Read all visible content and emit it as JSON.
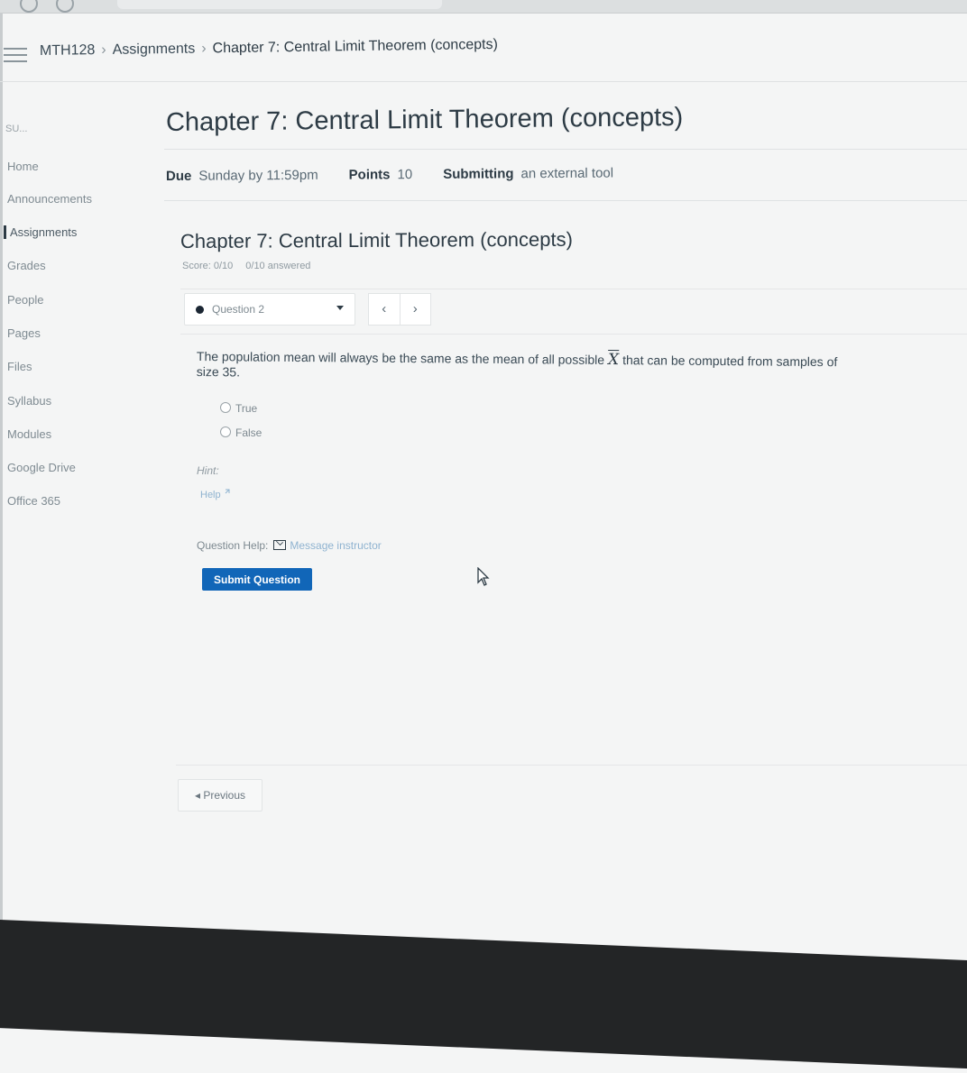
{
  "breadcrumb": [
    "MTH128",
    "Assignments",
    "Chapter 7: Central Limit Theorem (concepts)"
  ],
  "sidebar": {
    "course_code": "SU...",
    "items": [
      {
        "label": "Home",
        "active": false
      },
      {
        "label": "Announcements",
        "active": false
      },
      {
        "label": "Assignments",
        "active": true
      },
      {
        "label": "Grades",
        "active": false
      },
      {
        "label": "People",
        "active": false
      },
      {
        "label": "Pages",
        "active": false
      },
      {
        "label": "Files",
        "active": false
      },
      {
        "label": "Syllabus",
        "active": false
      },
      {
        "label": "Modules",
        "active": false
      },
      {
        "label": "Google Drive",
        "active": false
      },
      {
        "label": "Office 365",
        "active": false
      }
    ]
  },
  "page": {
    "title": "Chapter 7: Central Limit Theorem (concepts)",
    "due_label": "Due",
    "due_value": "Sunday by 11:59pm",
    "points_label": "Points",
    "points_value": "10",
    "submitting_label": "Submitting",
    "submitting_value": "an external tool"
  },
  "tool": {
    "title": "Chapter 7: Central Limit Theorem (concepts)",
    "score": "Score: 0/10",
    "answered": "0/10 answered",
    "question_select": "Question 2",
    "prev_arrow": "‹",
    "next_arrow": "›",
    "question_text_before": "The population mean will always be the same as the mean of all possible",
    "question_symbol": "X",
    "question_text_after": "that can be computed from samples of size 35.",
    "options": [
      "True",
      "False"
    ],
    "hint_label": "Hint:",
    "help_link": "Help",
    "question_help_label": "Question Help:",
    "message_instructor": "Message instructor",
    "submit_label": "Submit Question"
  },
  "footer": {
    "previous_label": "◂ Previous"
  },
  "colors": {
    "submit_button": "#1166b8",
    "link": "#8fb3d0",
    "text": "#2d3b45"
  },
  "icons": [
    "hamburger-icon",
    "chevron-down-icon",
    "mail-icon",
    "external-link-icon",
    "cursor-pointer-icon"
  ]
}
